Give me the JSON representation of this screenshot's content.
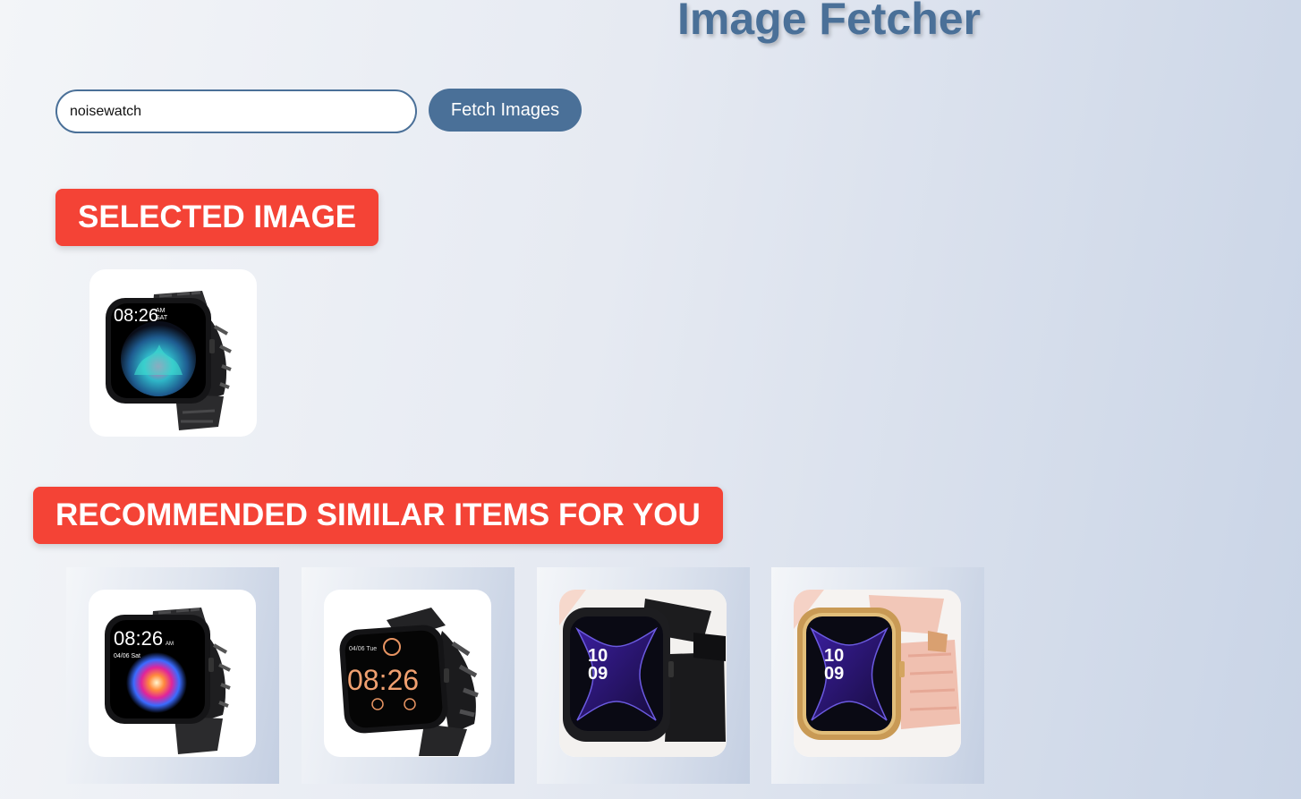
{
  "header": {
    "title": "Image Fetcher"
  },
  "search": {
    "value": "noisewatch",
    "button_label": "Fetch Images"
  },
  "selected": {
    "heading": "SELECTED IMAGE",
    "image": {
      "style": "black-metal",
      "time_top": "08:26",
      "time_bottom": "",
      "ampm": "AM",
      "day": "SAT"
    }
  },
  "recommended": {
    "heading": "RECOMMENDED SIMILAR ITEMS FOR YOU",
    "items": [
      {
        "style": "black-metal",
        "time_top": "08:26",
        "time_bottom": "",
        "ampm": "AM",
        "day": "04/06 Sat"
      },
      {
        "style": "black-metal-orange",
        "time_top": "08:26",
        "time_bottom": "",
        "ampm": "",
        "day": "04/06 Tue"
      },
      {
        "style": "black-silicone",
        "time_top": "10",
        "time_bottom": "09",
        "ampm": "",
        "day": ""
      },
      {
        "style": "gold-pink",
        "time_top": "10",
        "time_bottom": "09",
        "ampm": "",
        "day": ""
      }
    ]
  },
  "colors": {
    "accent": "#4a7098",
    "heading_bg": "#f44336",
    "text_on_heading": "#ffffff"
  }
}
